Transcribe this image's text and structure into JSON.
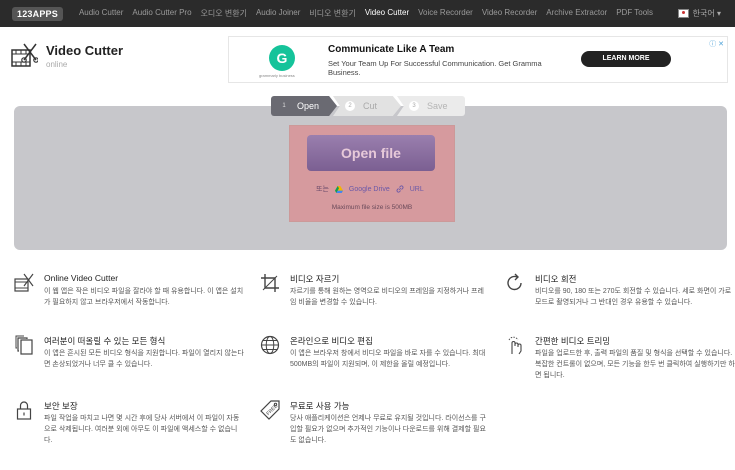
{
  "nav": {
    "logo": "123APPS",
    "items": [
      "Audio Cutter",
      "Audio Cutter Pro",
      "오디오 변환기",
      "Audio Joiner",
      "비디오 변환기",
      "Video Cutter",
      "Voice Recorder",
      "Video Recorder",
      "Archive Extractor",
      "PDF Tools"
    ],
    "active_index": 5,
    "language": "한국어 ▾"
  },
  "header": {
    "title": "Video Cutter",
    "subtitle": "online"
  },
  "ad": {
    "logo_letter": "G",
    "logo_text": "grammarly business",
    "title": "Communicate Like A Team",
    "description": "Set Your Team Up For Successful Communication. Get Gramma Business.",
    "button": "LEARN MORE",
    "choices": "ⓘ ✕"
  },
  "steps": [
    {
      "num": "1",
      "label": "Open"
    },
    {
      "num": "2",
      "label": "Cut"
    },
    {
      "num": "3",
      "label": "Save"
    }
  ],
  "upload": {
    "open_button": "Open file",
    "or_text": "또는",
    "google_drive": "Google Drive",
    "url": "URL",
    "max_size": "Maximum file size is 500MB"
  },
  "features": [
    {
      "icon": "video-file-icon",
      "title": "Online Video Cutter",
      "desc": "이 웹 앱은 작은 비디오 파일을 잘라야 할 때 유용합니다. 이 앱은 설치가 필요하지 않고 브라우저에서 작동합니다."
    },
    {
      "icon": "crop-icon",
      "title": "비디오 자르기",
      "desc": "자르기를 통해 원하는 영역으로 비디오의 프레임을 지정하거나 프레임 비율을 변경할 수 있습니다."
    },
    {
      "icon": "rotate-icon",
      "title": "비디오 회전",
      "desc": "비디오를 90, 180 또는 270도 회전할 수 있습니다. 세로 화면이 가로 모드로 촬영되거나 그 반대인 경우 유용할 수 있습니다."
    },
    {
      "icon": "files-icon",
      "title": "여러분이 떠올릴 수 있는 모든 형식",
      "desc": "이 앱은 흔시된 모든 비디오 형식을 지원합니다. 파일이 열리지 않는다면 손상되었거나 너무 클 수 있습니다."
    },
    {
      "icon": "globe-icon",
      "title": "온라인으로 비디오 편집",
      "desc": "이 앱은 브라우저 창에서 비디오 파일을 바로 자를 수 있습니다. 최대 500MB의 파일이 지원되며, 이 제한을 올릴 예정입니다."
    },
    {
      "icon": "touch-icon",
      "title": "간편한 비디오 트리밍",
      "desc": "파일을 업로드한 후, 출력 파일의 품질 및 형식을 선택할 수 있습니다. 복잡한 컨트롤이 없으며, 모든 기능을 한두 번 클릭하여 실행하기만 하면 됩니다."
    },
    {
      "icon": "lock-icon",
      "title": "보안 보장",
      "desc": "파일 작업을 마치고 나면 몇 시간 후에 당사 서버에서 이 파일이 자동으로 삭제됩니다. 여러분 외에 아무도 이 파일에 액세스할 수 없습니다."
    },
    {
      "icon": "free-tag-icon",
      "title": "무료로 사용 가능",
      "desc": "당사 애플리케이션은 언제나 무료로 유지될 것입니다. 라이선스를 구입할 필요가 없으며 추가적인 기능이나 다운로드를 위해 결제할 필요도 없습니다."
    }
  ]
}
